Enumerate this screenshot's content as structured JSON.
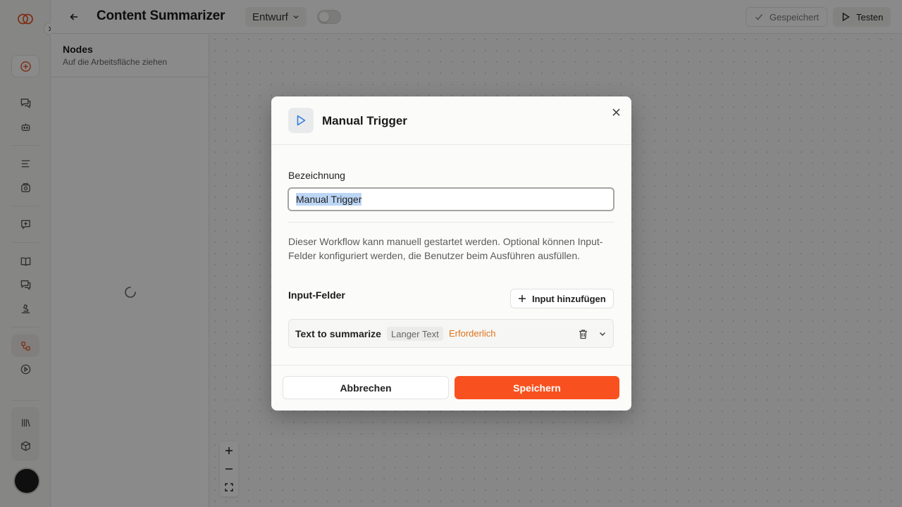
{
  "app": {
    "workflow_title": "Content Summarizer",
    "status_value": "Entwurf",
    "saved_label": "Gespeichert",
    "test_label": "Testen"
  },
  "sidebar": {
    "items": [
      {
        "icon": "plus-circle-icon"
      },
      {
        "icon": "chat-icon"
      },
      {
        "icon": "bot-icon"
      },
      {
        "icon": "list-icon"
      },
      {
        "icon": "image-icon"
      },
      {
        "icon": "reply-icon"
      },
      {
        "icon": "book-icon"
      },
      {
        "icon": "chats-icon"
      },
      {
        "icon": "microscope-icon"
      },
      {
        "icon": "workflow-icon",
        "active": true
      },
      {
        "icon": "play-circle-icon"
      },
      {
        "icon": "library-icon"
      },
      {
        "icon": "box-icon"
      }
    ]
  },
  "nodes_panel": {
    "title": "Nodes",
    "subtitle": "Auf die Arbeitsfläche ziehen"
  },
  "modal": {
    "title": "Manual Trigger",
    "name_label": "Bezeichnung",
    "name_value": "Manual Trigger",
    "description": "Dieser Workflow kann manuell gestartet werden. Optional können Input-Felder konfiguriert werden, die Benutzer beim Ausführen ausfüllen.",
    "inputs_label": "Input-Felder",
    "add_input_label": "Input hinzufügen",
    "input_fields": [
      {
        "name": "Text to summarize",
        "type": "Langer Text",
        "required": "Erforderlich"
      }
    ],
    "cancel_label": "Abbrechen",
    "save_label": "Speichern"
  },
  "colors": {
    "accent": "#f8511f",
    "required": "#e0731b",
    "play_icon": "#2f7de1"
  }
}
